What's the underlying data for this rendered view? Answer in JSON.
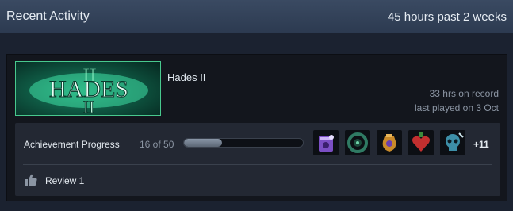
{
  "header": {
    "title": "Recent Activity",
    "hours_summary": "45 hours past 2 weeks"
  },
  "game": {
    "name": "Hades II",
    "banner_text": "HADES",
    "banner_numeral": "II",
    "hours_on_record": "33 hrs on record",
    "last_played": "last played on 3 Oct"
  },
  "achievements": {
    "label": "Achievement Progress",
    "count_text": "16 of 50",
    "progress_fraction": 0.32,
    "more_label": "+11",
    "badges": [
      {
        "icon": "purple-spellbook-icon",
        "color": "#7b4fc4"
      },
      {
        "icon": "green-wreath-icon",
        "color": "#2f7a63"
      },
      {
        "icon": "gold-urn-icon",
        "color": "#c98a2a"
      },
      {
        "icon": "red-heart-icon",
        "color": "#c22f2f"
      },
      {
        "icon": "teal-skull-icon",
        "color": "#3d8fa8"
      }
    ]
  },
  "review": {
    "label": "Review 1",
    "icon": "thumbs-up-icon"
  },
  "colors": {
    "header_bg": "#34445c",
    "card_bg": "#13161d",
    "panel_bg": "#232833",
    "banner_border": "#48c98e"
  }
}
